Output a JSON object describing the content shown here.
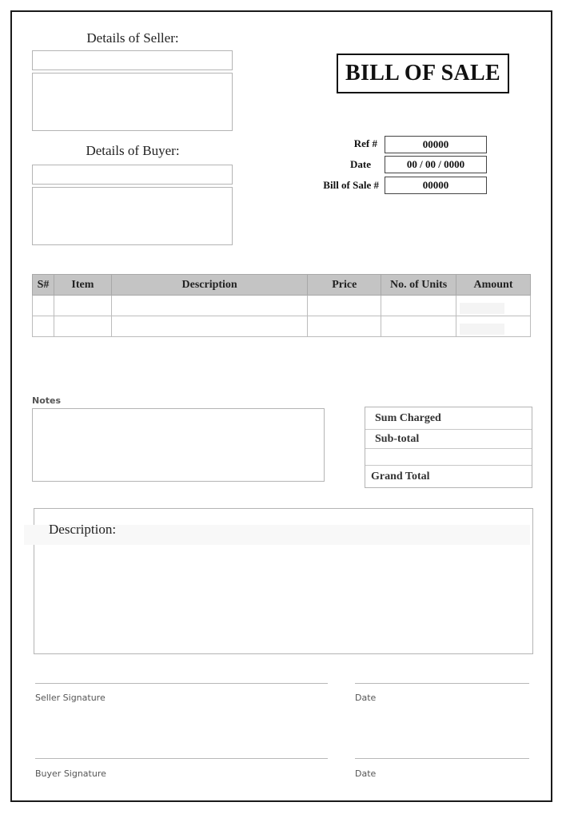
{
  "document": {
    "title": "BILL OF SALE"
  },
  "seller": {
    "heading": "Details of Seller:",
    "name_value": "",
    "address_value": ""
  },
  "buyer": {
    "heading": "Details of Buyer:",
    "name_value": "",
    "address_value": ""
  },
  "meta": {
    "ref_label": "Ref #",
    "ref_value": "00000",
    "date_label": "Date",
    "date_value": "00 / 00 / 0000",
    "bill_label": "Bill of Sale #",
    "bill_value": "00000"
  },
  "items_table": {
    "columns": [
      "S#",
      "Item",
      "Description",
      "Price",
      "No. of Units",
      "Amount"
    ],
    "rows": [
      [
        "",
        "",
        "",
        "",
        "",
        ""
      ],
      [
        "",
        "",
        "",
        "",
        "",
        ""
      ]
    ]
  },
  "notes": {
    "label": "Notes",
    "value": ""
  },
  "summary": {
    "rows": [
      {
        "label": "Sum Charged",
        "value": ""
      },
      {
        "label": "Sub-total",
        "value": ""
      },
      {
        "label": "",
        "value": ""
      },
      {
        "label": "Grand Total",
        "value": ""
      }
    ]
  },
  "description": {
    "label": "Description:",
    "value": ""
  },
  "signatures": {
    "seller_label": "Seller Signature",
    "seller_date_label": "Date",
    "buyer_label": "Buyer Signature",
    "buyer_date_label": "Date"
  }
}
